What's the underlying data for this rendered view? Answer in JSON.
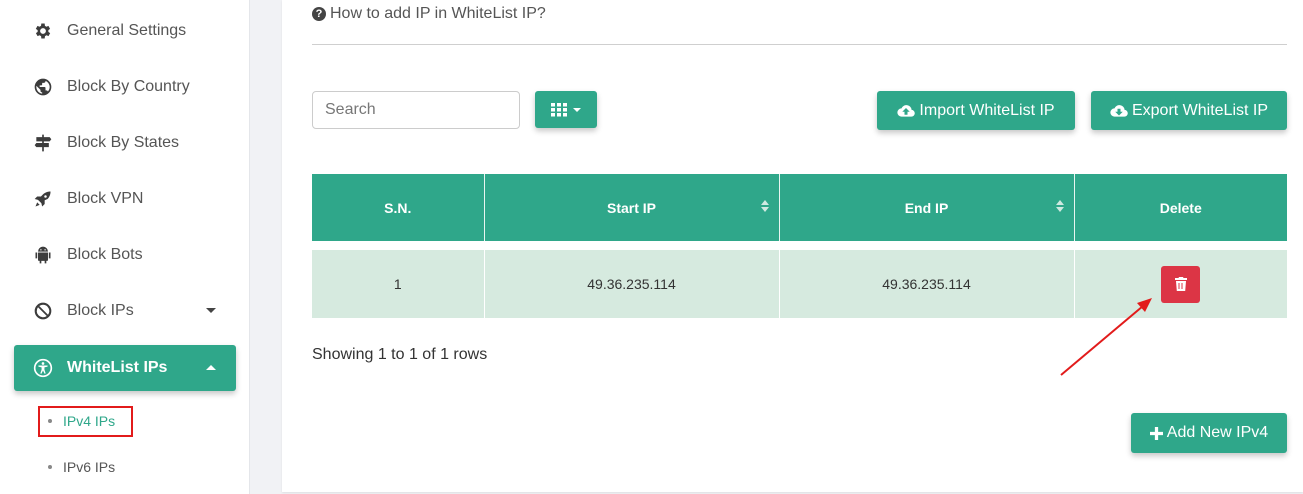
{
  "sidebar": {
    "items": [
      {
        "label": "General Settings",
        "icon": "gear-icon"
      },
      {
        "label": "Block By Country",
        "icon": "globe-icon"
      },
      {
        "label": "Block By States",
        "icon": "signpost-icon"
      },
      {
        "label": "Block VPN",
        "icon": "rocket-icon"
      },
      {
        "label": "Block Bots",
        "icon": "android-icon"
      },
      {
        "label": "Block IPs",
        "icon": "ban-icon"
      },
      {
        "label": "WhiteList IPs",
        "icon": "accessibility-icon"
      }
    ],
    "subitems": [
      {
        "label": "IPv4 IPs"
      },
      {
        "label": "IPv6 IPs"
      }
    ]
  },
  "help": {
    "text": "How to add IP in WhiteList IP?"
  },
  "toolbar": {
    "search_placeholder": "Search",
    "import_label": "Import WhiteList IP",
    "export_label": "Export WhiteList IP"
  },
  "table": {
    "headers": [
      "S.N.",
      "Start IP",
      "End IP",
      "Delete"
    ],
    "rows": [
      {
        "sn": "1",
        "start_ip": "49.36.235.114",
        "end_ip": "49.36.235.114"
      }
    ]
  },
  "pagination": {
    "text": "Showing 1 to 1 of 1 rows"
  },
  "add_button": {
    "label": "Add New IPv4"
  },
  "colors": {
    "accent": "#2fa78a",
    "danger": "#dc3545",
    "annotation": "#e21b1b"
  }
}
